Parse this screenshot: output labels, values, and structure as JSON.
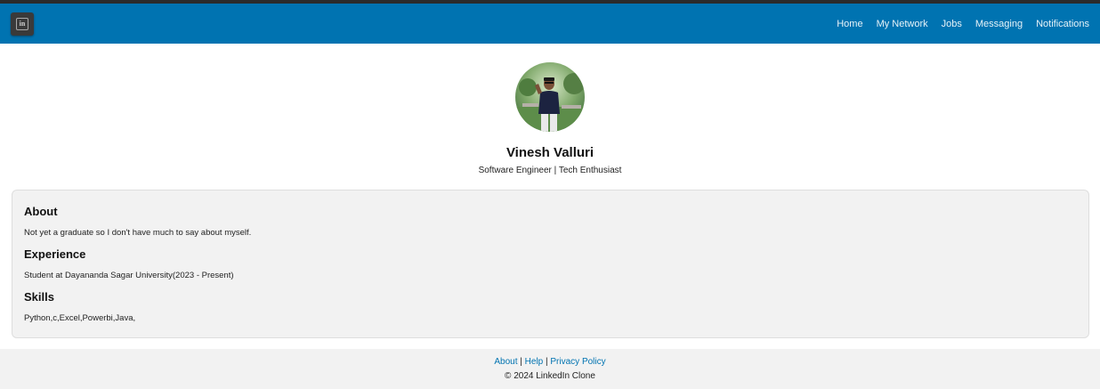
{
  "nav": {
    "links": [
      "Home",
      "My Network",
      "Jobs",
      "Messaging",
      "Notifications"
    ]
  },
  "profile": {
    "name": "Vinesh Valluri",
    "headline": "Software Engineer | Tech Enthusiast"
  },
  "sections": {
    "about": {
      "title": "About",
      "text": "Not yet a graduate so I don't have much to say about myself."
    },
    "experience": {
      "title": "Experience",
      "text": "Student at Dayananda Sagar University(2023 - Present)"
    },
    "skills": {
      "title": "Skills",
      "text": "Python,c,Excel,Powerbi,Java,"
    }
  },
  "footer": {
    "links": [
      "About",
      "Help",
      "Privacy Policy"
    ],
    "separator": " | ",
    "copyright": "© 2024 LinkedIn Clone"
  },
  "colors": {
    "brand": "#0073b1",
    "card_bg": "#f2f2f2"
  }
}
